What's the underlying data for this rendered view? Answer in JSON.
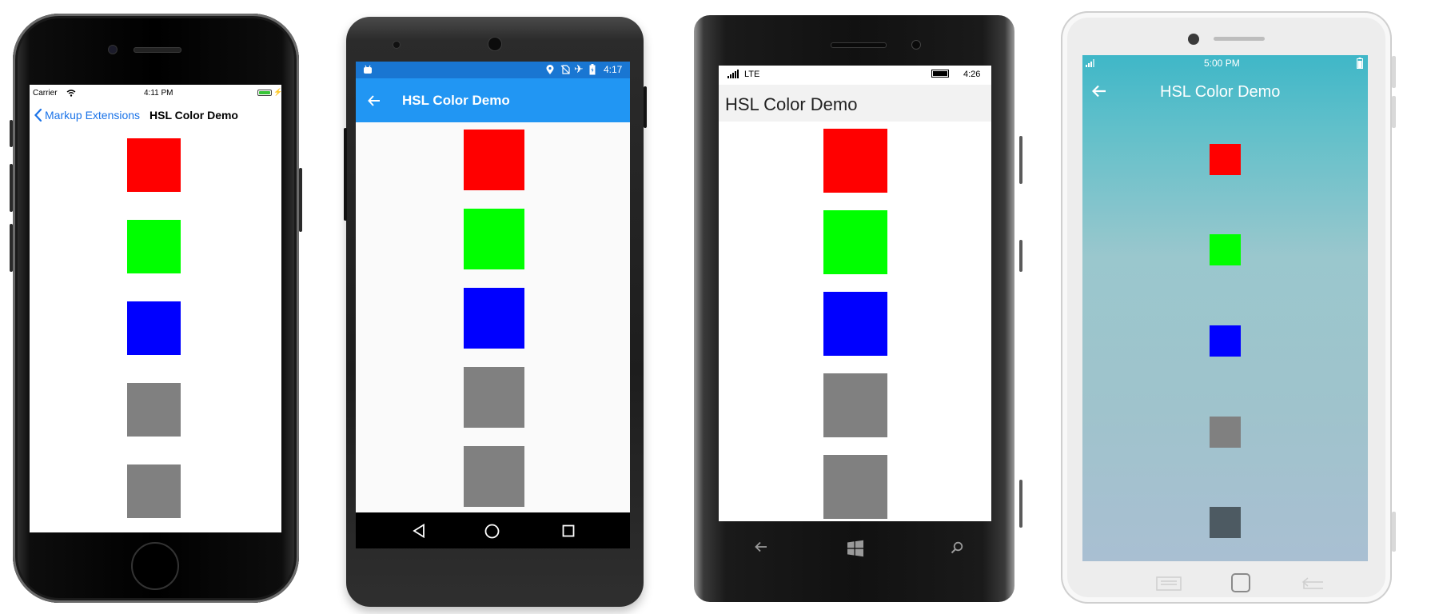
{
  "ios": {
    "status": {
      "carrier": "Carrier",
      "time": "4:11 PM"
    },
    "back_label": "Markup Extensions",
    "title": "HSL Color Demo"
  },
  "android": {
    "status": {
      "time": "4:17"
    },
    "title": "HSL Color Demo"
  },
  "windows": {
    "status": {
      "network": "LTE",
      "time": "4:26"
    },
    "title": "HSL Color Demo"
  },
  "tizen": {
    "status": {
      "time": "5:00 PM"
    },
    "title": "HSL Color Demo"
  },
  "colors": {
    "swatch_1": "#ff0000",
    "swatch_2": "#00ff00",
    "swatch_3": "#0000ff",
    "swatch_4": "#808080",
    "swatch_5": "#808080",
    "tizen_swatch_5": "#4d5a62",
    "ios_accent": "#1a73e8",
    "android_status": "#1976d2",
    "android_toolbar": "#2196f3"
  }
}
